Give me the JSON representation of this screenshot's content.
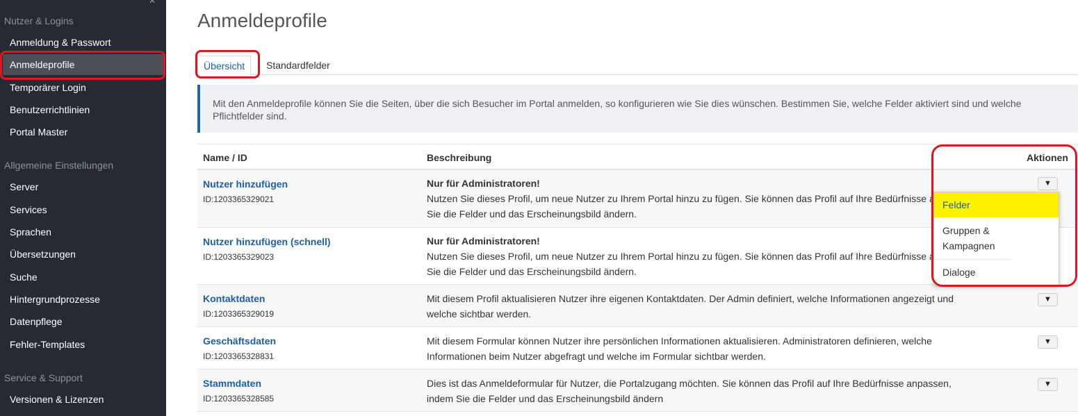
{
  "sidebar": {
    "sections": [
      {
        "title": "Nutzer & Logins",
        "items": [
          "Anmeldung & Passwort",
          "Anmeldeprofile",
          "Temporärer Login",
          "Benutzerrichtlinien",
          "Portal Master"
        ]
      },
      {
        "title": "Allgemeine Einstellungen",
        "items": [
          "Server",
          "Services",
          "Sprachen",
          "Übersetzungen",
          "Suche",
          "Hintergrundprozesse",
          "Datenpflege",
          "Fehler-Templates"
        ]
      },
      {
        "title": "Service & Support",
        "items": [
          "Versionen & Lizenzen"
        ]
      }
    ],
    "active_item": "Anmeldeprofile"
  },
  "page": {
    "title": "Anmeldeprofile",
    "tabs": [
      "Übersicht",
      "Standardfelder"
    ],
    "info": "Mit den Anmeldeprofile können Sie die Seiten, über die sich Besucher im Portal anmelden, so konfigurieren wie Sie dies wünschen. Bestimmen Sie, welche Felder aktiviert sind und welche Pflichtfelder sind."
  },
  "table": {
    "headers": {
      "name": "Name / ID",
      "desc": "Beschreibung",
      "actions": "Aktionen"
    },
    "rows": [
      {
        "name": "Nutzer hinzufügen",
        "id": "ID:1203365329021",
        "bold": "Nur für Administratoren!",
        "desc": "Nutzen Sie dieses Profil, um neue Nutzer zu Ihrem Portal hinzu zu fügen. Sie können das Profil auf Ihre Bedürfnisse anpassen, indem Sie die Felder und das Erscheinungsbild ändern."
      },
      {
        "name": "Nutzer hinzufügen (schnell)",
        "id": "ID:1203365329023",
        "bold": "Nur für Administratoren!",
        "desc": "Nutzen Sie dieses Profil, um neue Nutzer zu Ihrem Portal hinzu zu fügen. Sie können das Profil auf Ihre Bedürfnisse anpassen, indem Sie die Felder und das Erscheinungsbild ändern."
      },
      {
        "name": "Kontaktdaten",
        "id": "ID:1203365329019",
        "bold": "",
        "desc": "Mit diesem Profil aktualisieren Nutzer ihre eigenen Kontaktdaten. Der Admin definiert, welche Informationen angezeigt und welche sichtbar werden."
      },
      {
        "name": "Geschäftsdaten",
        "id": "ID:1203365328831",
        "bold": "",
        "desc": "Mit diesem Formular können Nutzer ihre persönlichen Informationen aktualisieren. Administratoren definieren, welche Informationen beim Nutzer abgefragt und welche im Formular sichtbar werden."
      },
      {
        "name": "Stammdaten",
        "id": "ID:1203365328585",
        "bold": "",
        "desc": "Dies ist das Anmeldeformular für Nutzer, die Portalzugang möchten. Sie können das Profil auf Ihre Bedürfnisse anpassen, indem Sie die Felder und das Erscheinungsbild ändern"
      }
    ]
  },
  "dropdown": {
    "items": [
      "Felder",
      "Gruppen & Kampagnen",
      "Dialoge"
    ],
    "highlighted": "Felder"
  },
  "colors": {
    "sidebar_bg": "#262b33",
    "link": "#1a5fa8",
    "highlight": "#fff200",
    "annotation": "#e0151f"
  }
}
